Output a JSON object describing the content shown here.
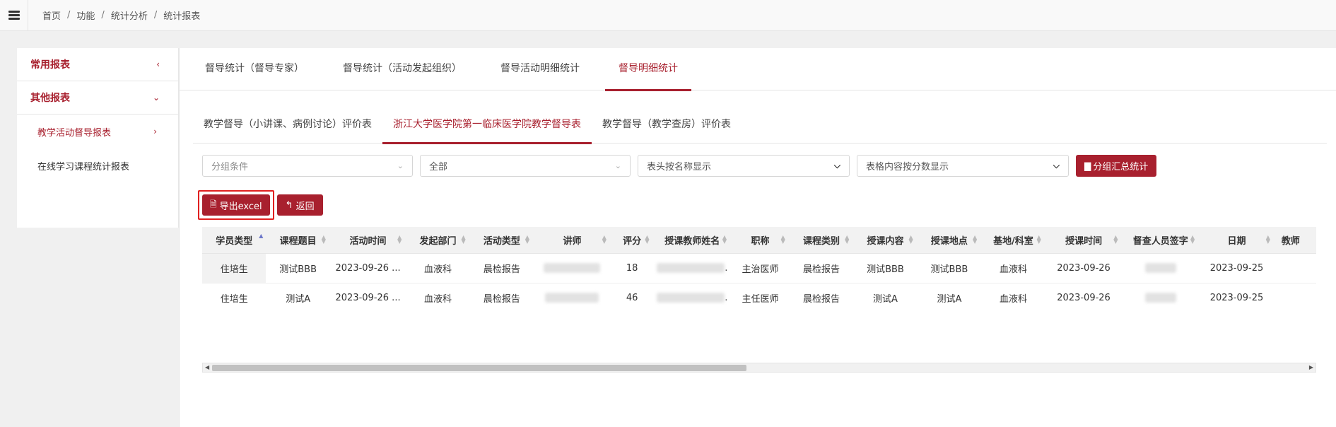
{
  "breadcrumb": [
    "首页",
    "功能",
    "统计分析",
    "统计报表"
  ],
  "sidebar": {
    "common_reports": "常用报表",
    "other_reports": "其他报表",
    "items": [
      "教学活动督导报表",
      "在线学习课程统计报表"
    ]
  },
  "top_tabs": [
    "督导统计（督导专家）",
    "督导统计（活动发起组织）",
    "督导活动明细统计",
    "督导明细统计"
  ],
  "sub_tabs": [
    "教学督导（小讲课、病例讨论）评价表",
    "浙江大学医学院第一临床医学院教学督导表",
    "教学督导（教学查房）评价表"
  ],
  "filters": {
    "group_condition": "分组条件",
    "all": "全部",
    "header_display": "表头按名称显示",
    "content_display": "表格内容按分数显示",
    "group_summary": "分组汇总统计"
  },
  "actions": {
    "export": "导出excel",
    "back": "返回"
  },
  "table": {
    "columns": [
      "学员类型",
      "课程题目",
      "活动时间",
      "发起部门",
      "活动类型",
      "讲师",
      "评分",
      "授课教师姓名",
      "职称",
      "课程类别",
      "授课内容",
      "授课地点",
      "基地/科室",
      "授课时间",
      "督查人员签字",
      "日期",
      "教师"
    ],
    "rows": [
      [
        "住培生",
        "测试BBB",
        "2023-09-26 ...",
        "血液科",
        "晨检报告",
        "",
        "18",
        "",
        "主治医师",
        "晨检报告",
        "测试BBB",
        "测试BBB",
        "血液科",
        "2023-09-26",
        "",
        "2023-09-25",
        ""
      ],
      [
        "住培生",
        "测试A",
        "2023-09-26 ...",
        "血液科",
        "晨检报告",
        "",
        "46",
        "",
        "主任医师",
        "晨检报告",
        "测试A",
        "测试A",
        "血液科",
        "2023-09-26",
        "",
        "2023-09-25",
        ""
      ]
    ]
  },
  "colors": {
    "accent": "#a8202e",
    "highlight": "#e02020"
  }
}
